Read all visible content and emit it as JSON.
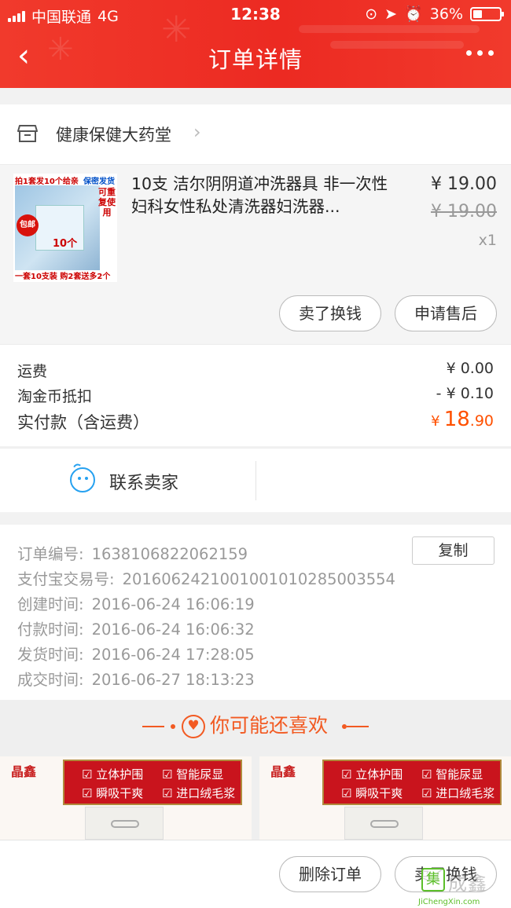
{
  "status_bar": {
    "carrier": "中国联通",
    "network": "4G",
    "time": "12:38",
    "battery": "36%"
  },
  "nav": {
    "title": "订单详情"
  },
  "shop": {
    "name": "健康保健大药堂"
  },
  "product": {
    "title": "10支 洁尔阴阴道冲洗器具 非一次性妇科女性私处清洗器妇洗器...",
    "price": "¥ 19.00",
    "original_price": "¥ 19.00",
    "quantity": "x1",
    "thumb_text": {
      "top_left": "拍1套发10个给亲",
      "top_right": "保密发货",
      "badge": "包邮",
      "count": "10个",
      "vertical": "可重复使用",
      "bottom": "一套10支装 购2套送多2个"
    },
    "buttons": {
      "sell": "卖了换钱",
      "after_sale": "申请售后"
    }
  },
  "fees": {
    "shipping_label": "运费",
    "shipping_value": "¥ 0.00",
    "coin_label": "淘金币抵扣",
    "coin_value": "- ¥ 0.10",
    "paid_label": "实付款（含运费）",
    "paid_yen": "¥",
    "paid_int": "18",
    "paid_dec": ".90"
  },
  "contact": {
    "label": "联系卖家"
  },
  "order_info": {
    "copy_button": "复制",
    "rows": [
      {
        "label": "订单编号:",
        "value": "1638106822062159"
      },
      {
        "label": "支付宝交易号:",
        "value": "2016062421001001010285003554"
      },
      {
        "label": "创建时间:",
        "value": "2016-06-24 16:06:19"
      },
      {
        "label": "付款时间:",
        "value": "2016-06-24 16:06:32"
      },
      {
        "label": "发货时间:",
        "value": "2016-06-24 17:28:05"
      },
      {
        "label": "成交时间:",
        "value": "2016-06-27 18:13:23"
      }
    ]
  },
  "recommend": {
    "heading": "你可能还喜欢",
    "cards": [
      {
        "brand": "晶鑫",
        "features": [
          "立体护围",
          "智能尿显",
          "瞬吸干爽",
          "进口绒毛浆"
        ]
      },
      {
        "brand": "晶鑫",
        "features": [
          "立体护围",
          "智能尿显",
          "瞬吸干爽",
          "进口绒毛浆"
        ]
      }
    ]
  },
  "bottom": {
    "delete": "删除订单",
    "sell": "卖了换钱"
  },
  "watermark": {
    "text": "成鑫",
    "url": "JiChengXin.com"
  },
  "colors": {
    "header_red": "#ec2a22",
    "price_orange": "#ff5000",
    "contact_blue": "#26a1f0"
  }
}
